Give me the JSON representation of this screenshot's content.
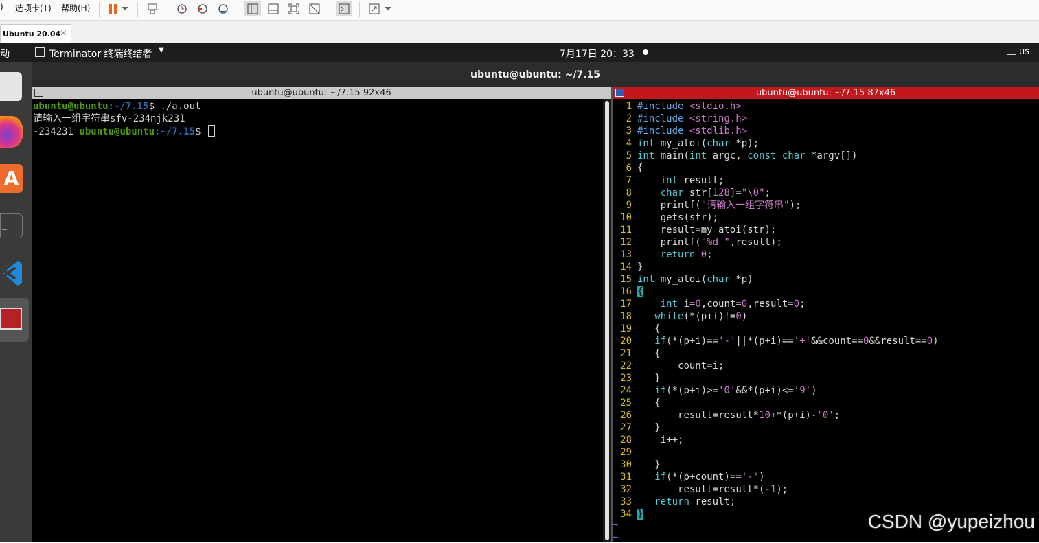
{
  "vm": {
    "menu": [
      "选项卡(T)",
      "帮助(H)"
    ],
    "tab_label": "Ubuntu 20.04"
  },
  "gnome": {
    "activities": "动",
    "app_name": "Terminator 终端终结者",
    "clock": "7月17日  20：33",
    "keyboard": "us"
  },
  "terminator": {
    "window_title": "ubuntu@ubuntu: ~/7.15",
    "left_title": "ubuntu@ubuntu: ~/7.15 92x46",
    "right_title": "ubuntu@ubuntu: ~/7.15 87x46",
    "left_lines": {
      "l1_user": "ubuntu@ubuntu",
      "l1_path": ":~/7.15",
      "l1_cmd": "$ ./a.out",
      "l2": "请输入一组字符串sfv-234njk231",
      "l3_out": "-234231 ",
      "l3_user": "ubuntu@ubuntu",
      "l3_path": ":~/7.15",
      "l3_prompt": "$ "
    }
  },
  "editor": {
    "lines": [
      "#include <stdio.h>",
      "#include <string.h>",
      "#include <stdlib.h>",
      "int my_atoi(char *p);",
      "int main(int argc, const char *argv[])",
      "{",
      "    int result;",
      "    char str[128]=\"\\0\";",
      "    printf(\"请输入一组字符串\");",
      "    gets(str);",
      "    result=my_atoi(str);",
      "    printf(\"%d \",result);",
      "    return 0;",
      "}",
      "int my_atoi(char *p)",
      "{",
      "    int i=0,count=0,result=0;",
      "   while(*(p+i)!=0)",
      "   {",
      "   if(*(p+i)=='-'||*(p+i)=='+'&&count==0&&result==0)",
      "   {",
      "       count=i;",
      "   }",
      "   if(*(p+i)>='0'&&*(p+i)<='9')",
      "   {",
      "       result=result*10+*(p+i)-'0';",
      "   }",
      "    i++;",
      "",
      "   }",
      "   if(*(p+count)=='-')",
      "       result=result*(-1);",
      "   return result;",
      "}"
    ],
    "tildes": [
      "~",
      "~"
    ]
  },
  "watermark": "CSDN @yupeizhou"
}
